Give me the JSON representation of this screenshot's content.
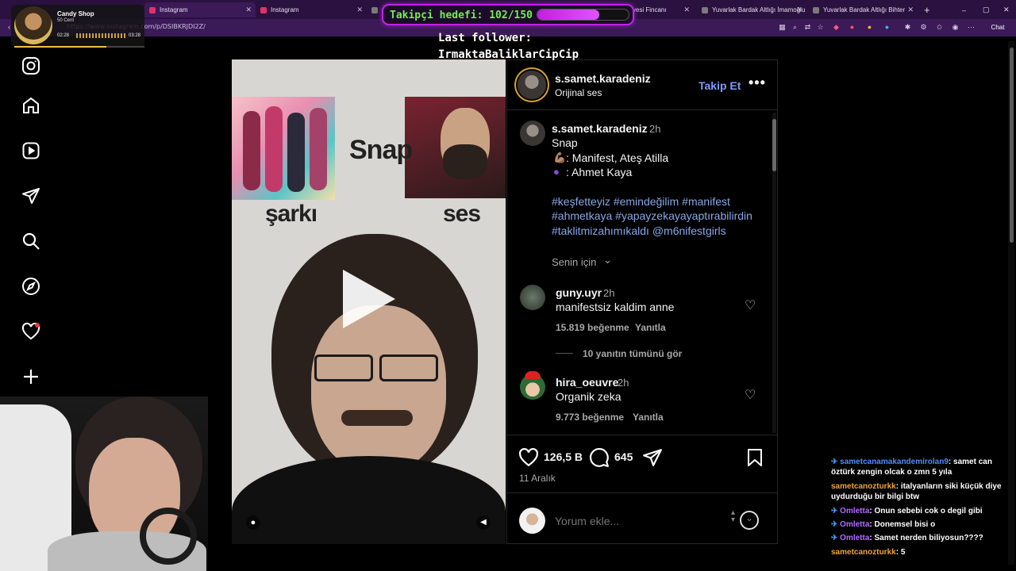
{
  "browser": {
    "tabs": [
      {
        "title": "Instagram",
        "active": true
      },
      {
        "title": "Instagram",
        "active": false
      },
      {
        "title": "ahvesi Fincanı",
        "active": false
      },
      {
        "title": "Yuvarlak Bardak Altlığı İmamoğlu",
        "active": false
      },
      {
        "title": "Yuvarlak Bardak Altlığı Bihter",
        "active": false
      }
    ],
    "url": "https://www.instagram.com/p/DSIBKRJDI2Z/",
    "chat_button": "Chat"
  },
  "music_widget": {
    "title": "Candy Shop",
    "artist": "50 Cent",
    "elapsed": "02:28",
    "duration": "03:28",
    "progress": 0.71
  },
  "follower_goal": {
    "label": "Takipçi hedefi: 102/150",
    "current": 102,
    "target": 150,
    "last_follower_label": "Last follower:",
    "last_follower_name": "IrmaktaBaliklarCipCip"
  },
  "sidebar": {
    "items": [
      "instagram-logo-icon",
      "home-icon",
      "reels-icon",
      "messages-icon",
      "search-icon",
      "explore-icon",
      "notifications-icon",
      "create-icon",
      "dashboard-icon"
    ]
  },
  "video": {
    "caption_top": "Snap",
    "label_left": "şarkı",
    "label_right": "ses"
  },
  "post": {
    "username": "s.samet.karadeniz",
    "audio": "Orijinal ses",
    "follow_label": "Takip Et",
    "caption_user": "s.samet.karadeniz",
    "caption_time": "2h",
    "caption_title": "Snap",
    "caption_line1": ": Manifest, Ateş Atilla",
    "caption_line2": ": Ahmet Kaya",
    "hashtags_line1": "#keşfetteyiz #emindeğilim #manifest",
    "hashtags_line2": "#ahmetkaya #yapayzekayayaptırabilirdin",
    "hashtags_line3": "#taklitmizahımıkaldı @m6nifestgirls",
    "for_you": "Senin için",
    "comments": [
      {
        "user": "guny.uyr",
        "time": "2h",
        "text": "manifestsiz kaldim anne",
        "likes": "15.819 beğenme",
        "reply": "Yanıtla",
        "view_replies": "10 yanıtın tümünü gör"
      },
      {
        "user": "hira_oeuvre",
        "time": "2h",
        "text": "Organik zeka",
        "likes": "9.773 beğenme",
        "reply": "Yanıtla"
      }
    ],
    "like_count": "126,5 B",
    "comment_count": "645",
    "date": "11 Aralık",
    "comment_placeholder": "Yorum ekle..."
  },
  "stream_chat": [
    {
      "user": "sametcanamakandemirolan9",
      "text": "samet can öztürk zengin olcak o zmn 5 yıla",
      "color": "#4f8cff",
      "pinned": true
    },
    {
      "user": "sametcanozturkk",
      "text": "italyanların siki küçük diye uydurduğu bir bilgi btw",
      "color": "#f0a33a",
      "pinned": false
    },
    {
      "user": "Omletta",
      "text": "Onun sebebi cok o degil gibi",
      "color": "#b06bff",
      "pinned": true
    },
    {
      "user": "Omletta",
      "text": "Donemsel bisi o",
      "color": "#b06bff",
      "pinned": true
    },
    {
      "user": "Omletta",
      "text": "Samet nerden biliyosun????",
      "color": "#b06bff",
      "pinned": true
    },
    {
      "user": "sametcanozturkk",
      "text": "5",
      "color": "#f0a33a",
      "pinned": false
    }
  ]
}
